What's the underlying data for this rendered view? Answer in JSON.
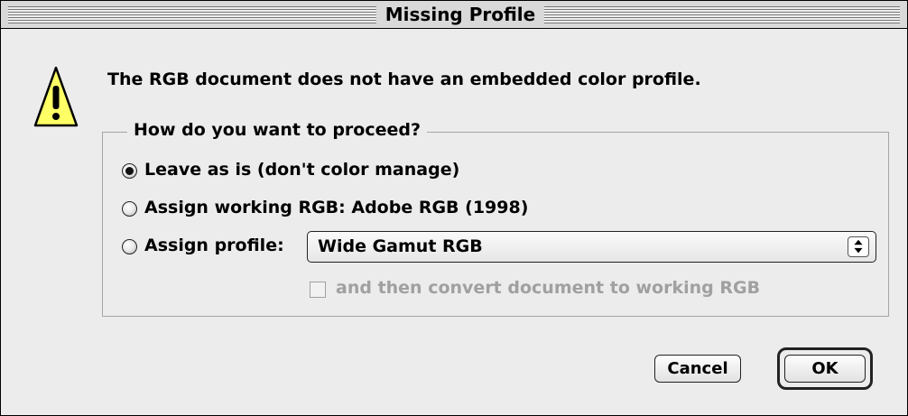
{
  "window": {
    "title": "Missing Profile"
  },
  "alert": {
    "icon": "warning-icon",
    "message": "The RGB document does not have an embedded color profile."
  },
  "options": {
    "group_title": "How do you want to proceed?",
    "leave_as_is": {
      "label": "Leave as is (don't color manage)",
      "selected": true
    },
    "assign_working": {
      "label": "Assign working RGB: Adobe RGB (1998)",
      "selected": false
    },
    "assign_profile": {
      "label": "Assign profile:",
      "selected": false
    },
    "profile_select": {
      "value": "Wide Gamut RGB",
      "icon": "popup-arrows-icon"
    },
    "convert_checkbox": {
      "label": "and then convert document to working RGB",
      "checked": false,
      "enabled": false
    }
  },
  "buttons": {
    "cancel": "Cancel",
    "ok": "OK"
  },
  "colors": {
    "window_bg": "#ececec",
    "warning_fill": "#ffff66",
    "disabled_text": "#a0a0a0"
  }
}
